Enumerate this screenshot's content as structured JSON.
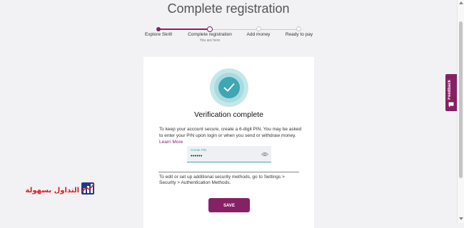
{
  "page": {
    "title": "Complete registration"
  },
  "steps": [
    {
      "label": "Explore Skrill",
      "state": "done"
    },
    {
      "label": "Complete registration",
      "sublabel": "You are here",
      "state": "current"
    },
    {
      "label": "Add money",
      "state": "todo"
    },
    {
      "label": "Ready to pay",
      "state": "todo"
    }
  ],
  "card": {
    "badge_icon": "check-icon",
    "heading": "Verification complete",
    "description": "To keep your account secure, create a 6-digit PIN. You may be asked to enter your PIN upon login or when you send or withdraw money.",
    "learn_more": "Learn More",
    "pin": {
      "label": "Create PIN",
      "value": "••••••"
    },
    "security_text": "To edit or set up additional security methods, go to Settings > Security > Authentication Methods.",
    "save_label": "SAVE"
  },
  "feedback": {
    "label": "Feedback"
  },
  "watermark": {
    "text": "التداول بسهولة"
  },
  "colors": {
    "brand": "#862165",
    "accent": "#3fa6b3",
    "background": "#f2f2f4"
  }
}
